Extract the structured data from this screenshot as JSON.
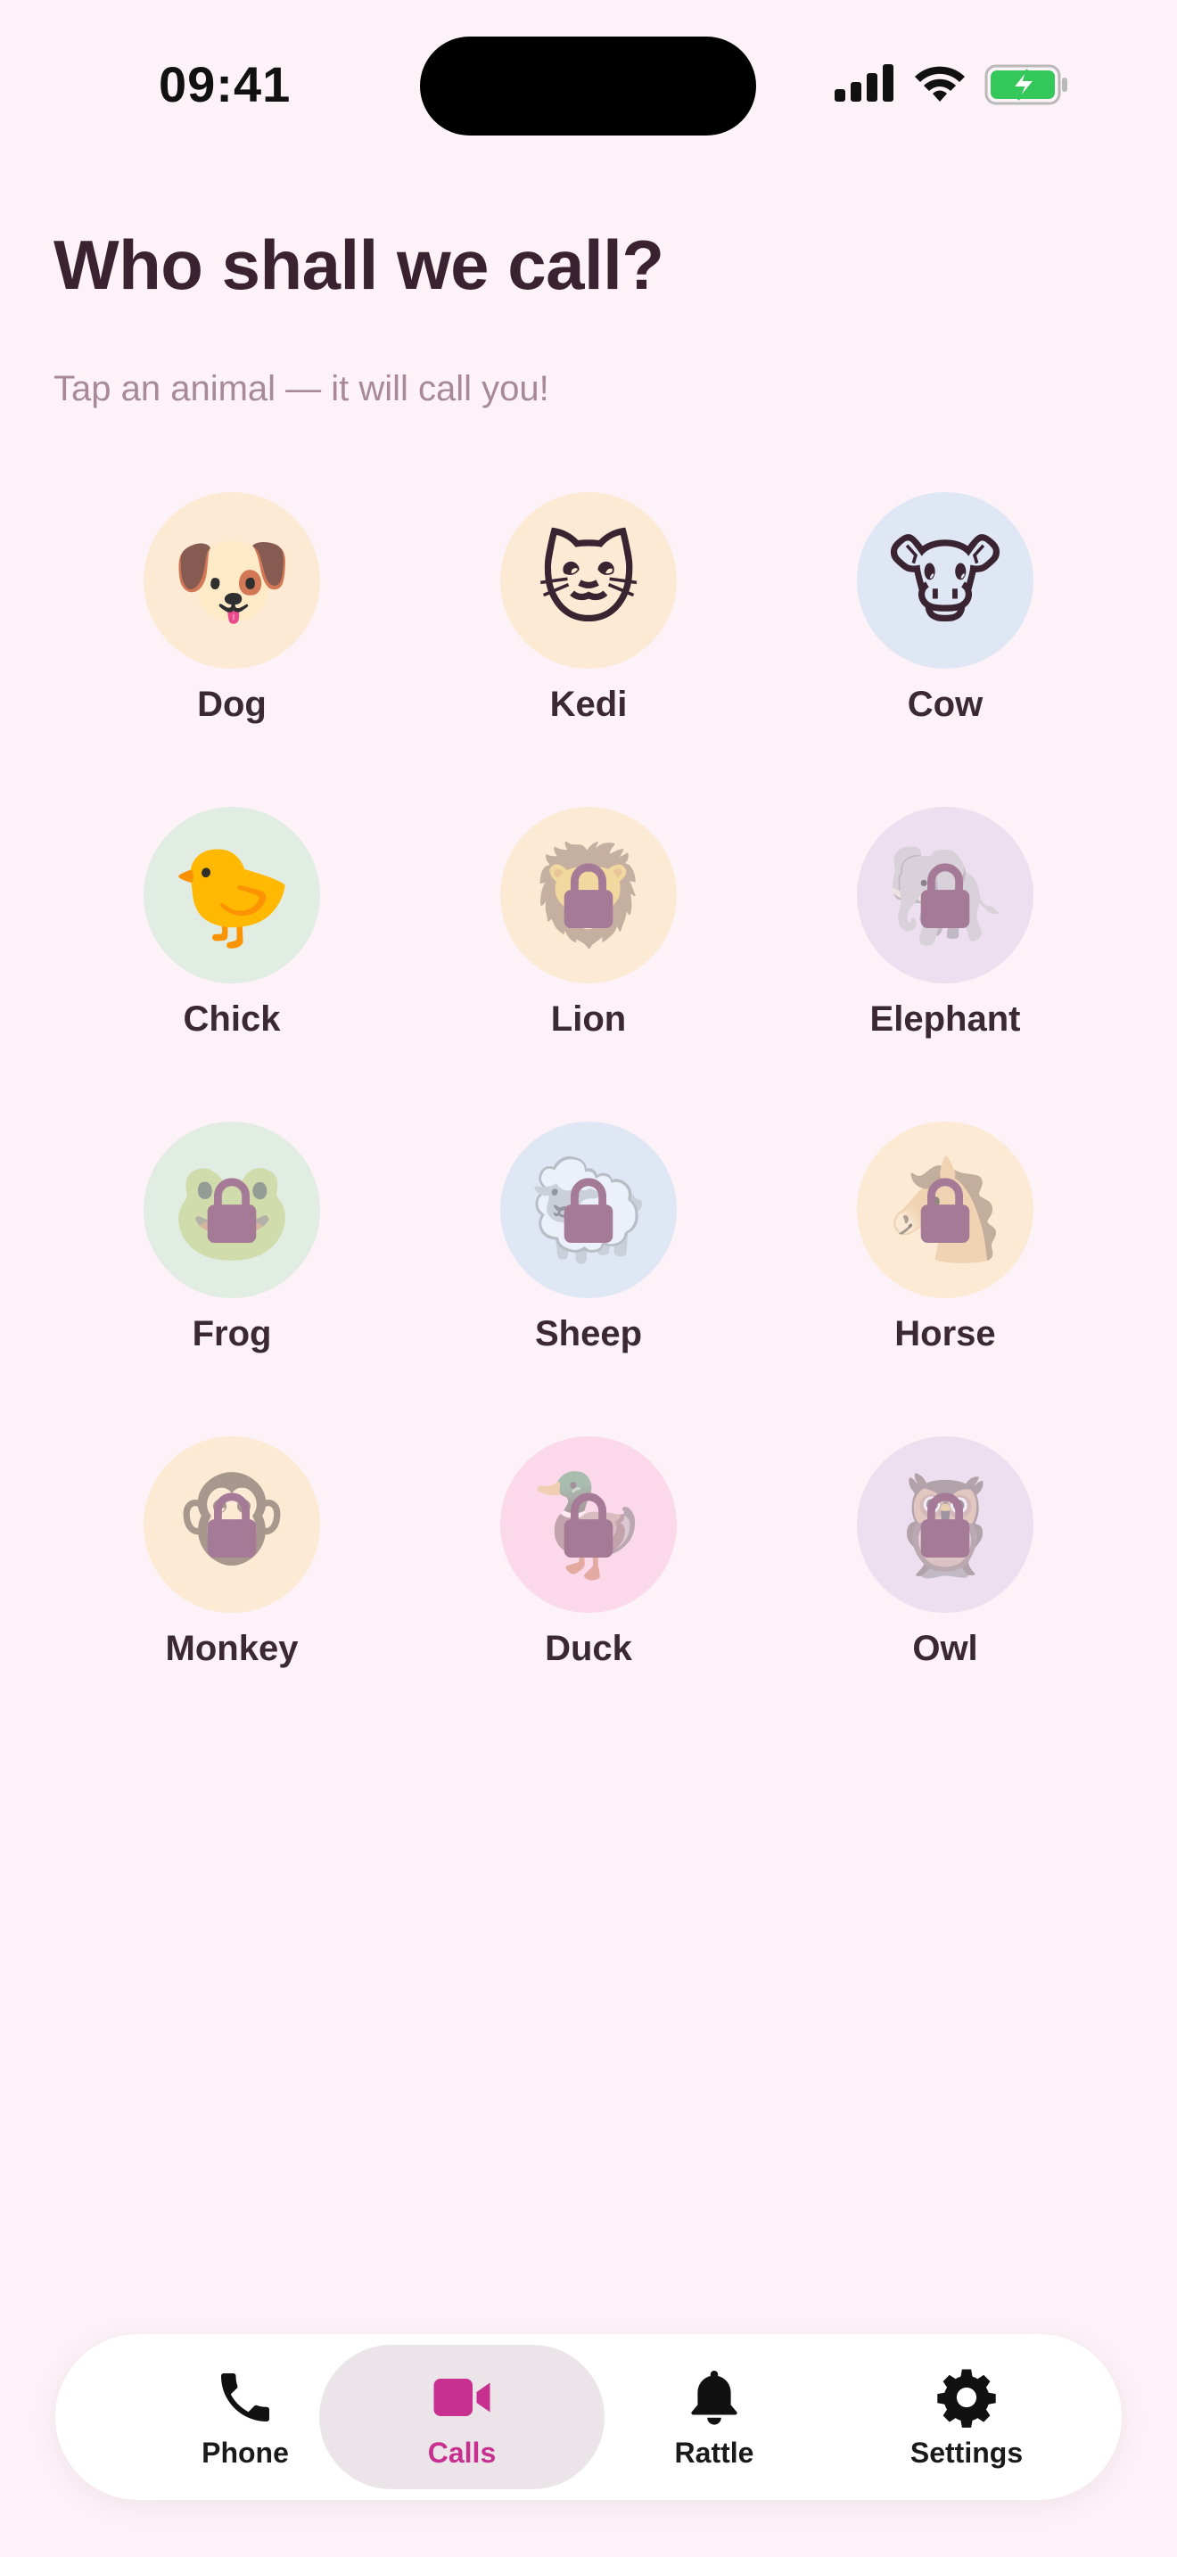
{
  "status_bar": {
    "time": "09:41",
    "icons": [
      "cellular-signal-icon",
      "wifi-icon",
      "battery-charging-icon"
    ]
  },
  "header": {
    "title": "Who shall we call?",
    "subtitle": "Tap an animal — it will call you!"
  },
  "animals": [
    {
      "name": "Dog",
      "emoji": "🐶",
      "bg": "#fdead4",
      "locked": false
    },
    {
      "name": "Kedi",
      "emoji": "🐱",
      "bg": "#fdead4",
      "locked": false
    },
    {
      "name": "Cow",
      "emoji": "🐮",
      "bg": "#dfe7f5",
      "locked": false
    },
    {
      "name": "Chick",
      "emoji": "🐤",
      "bg": "#e1ece2",
      "locked": false
    },
    {
      "name": "Lion",
      "emoji": "🦁",
      "bg": "#fdead4",
      "locked": true
    },
    {
      "name": "Elephant",
      "emoji": "🐘",
      "bg": "#eddff0",
      "locked": true
    },
    {
      "name": "Frog",
      "emoji": "🐸",
      "bg": "#e1ece2",
      "locked": true
    },
    {
      "name": "Sheep",
      "emoji": "🐑",
      "bg": "#dfe7f5",
      "locked": true
    },
    {
      "name": "Horse",
      "emoji": "🐴",
      "bg": "#fdead4",
      "locked": true
    },
    {
      "name": "Monkey",
      "emoji": "🐵",
      "bg": "#fdead4",
      "locked": true
    },
    {
      "name": "Duck",
      "emoji": "🦆",
      "bg": "#fbd9ea",
      "locked": true
    },
    {
      "name": "Owl",
      "emoji": "🦉",
      "bg": "#eddff0",
      "locked": true
    }
  ],
  "tabs": [
    {
      "label": "Phone",
      "icon": "phone-icon",
      "active": false
    },
    {
      "label": "Calls",
      "icon": "video-camera-icon",
      "active": true
    },
    {
      "label": "Rattle",
      "icon": "bell-icon",
      "active": false
    },
    {
      "label": "Settings",
      "icon": "gear-icon",
      "active": false
    }
  ],
  "colors": {
    "background": "#fcf2f7",
    "accent": "#c8308f",
    "lock": "#a57a96"
  }
}
